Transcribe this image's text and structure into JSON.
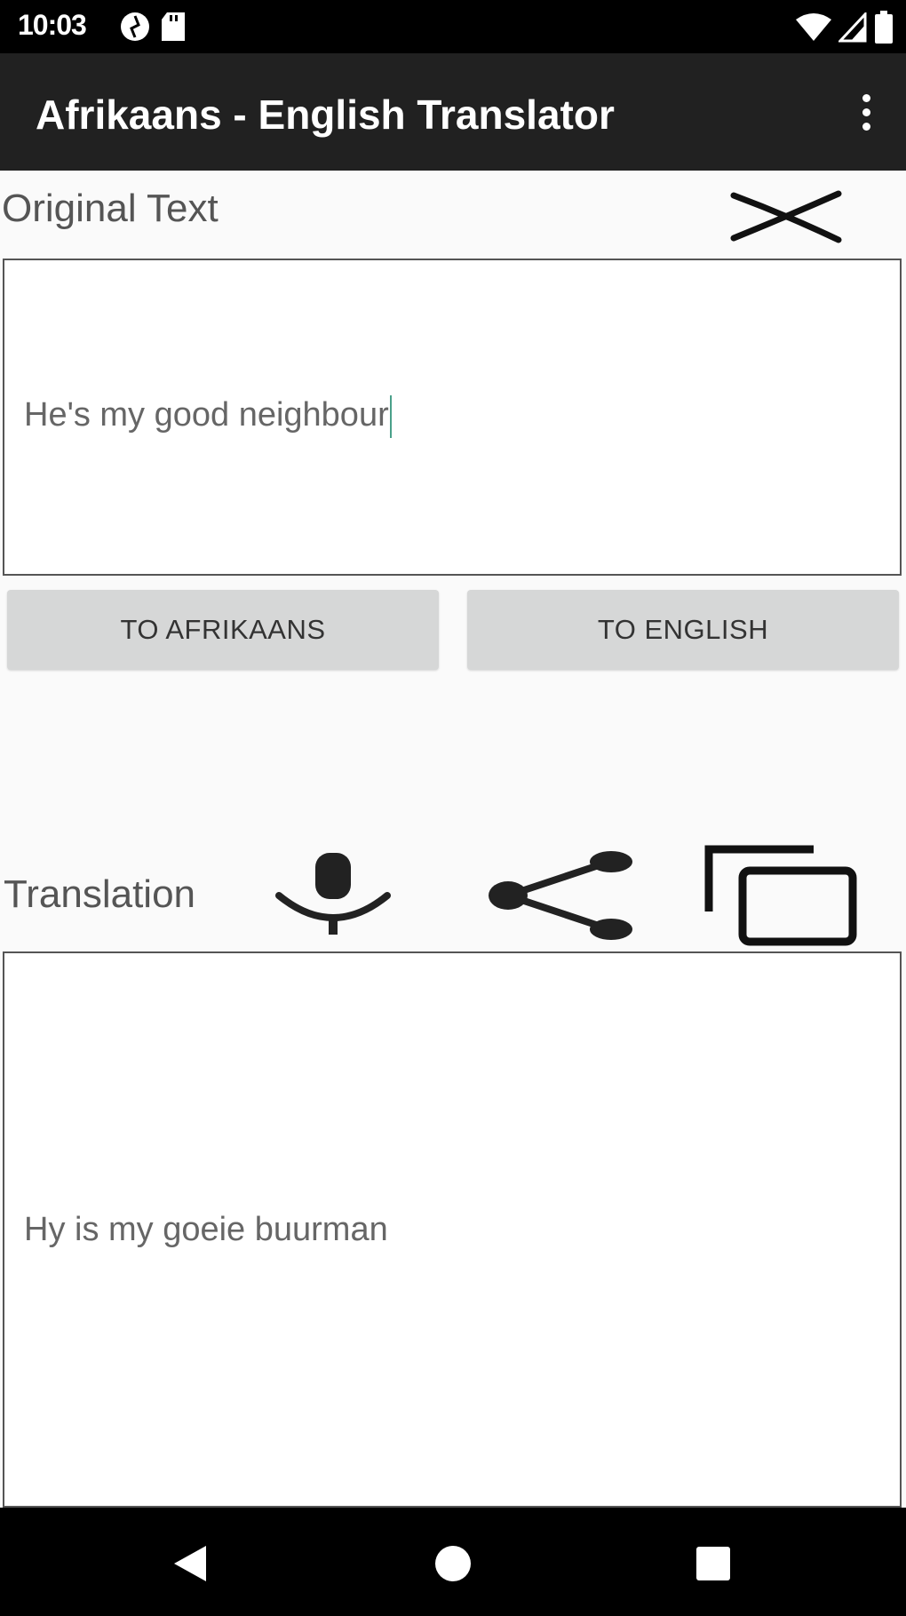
{
  "status_bar": {
    "time": "10:03",
    "left_icons": [
      "data-saver-icon",
      "sd-card-icon"
    ],
    "right_icons": [
      "wifi-icon",
      "cell-signal-icon",
      "battery-icon"
    ]
  },
  "app_bar": {
    "title": "Afrikaans - English Translator",
    "menu_icon": "overflow-menu-icon"
  },
  "original": {
    "label": "Original Text",
    "value": "He's my good neighbour",
    "clear_icon": "close-icon"
  },
  "buttons": {
    "to_afrikaans": "TO AFRIKAANS",
    "to_english": "TO ENGLISH"
  },
  "translation": {
    "label": "Translation",
    "value": "Hy is my goeie buurman",
    "icons": [
      "microphone-icon",
      "share-icon",
      "copy-icon"
    ]
  },
  "nav_bar": {
    "icons": [
      "back-icon",
      "home-icon",
      "recents-icon"
    ]
  },
  "colors": {
    "app_bar": "#212121",
    "background": "#fafafa",
    "button": "#d6d7d7",
    "caret": "#4aa08a"
  }
}
